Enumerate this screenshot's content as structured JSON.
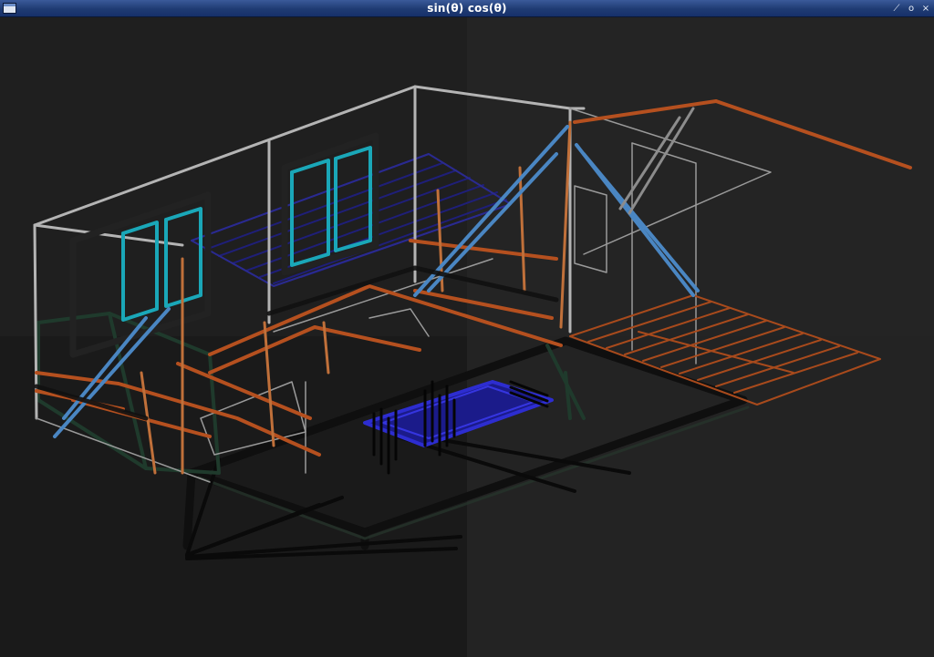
{
  "window": {
    "title": "sin(θ) cos(θ)",
    "buttons": {
      "minimize_glyph": "⟋",
      "maximize_glyph": "o",
      "close_glyph": "×"
    }
  },
  "scene": {
    "background_color": "#1f1f1f",
    "colors": {
      "frame_white": "#b9b9b9",
      "window_cyan": "#1aa7b8",
      "beam_orange": "#b5501f",
      "brace_blue": "#4a86c2",
      "slab_black": "#0d0d0d",
      "floor_dark_green": "#1f2a22",
      "pool_blue": "#2a2ad0",
      "grid_navy": "#1c1c6e"
    }
  }
}
